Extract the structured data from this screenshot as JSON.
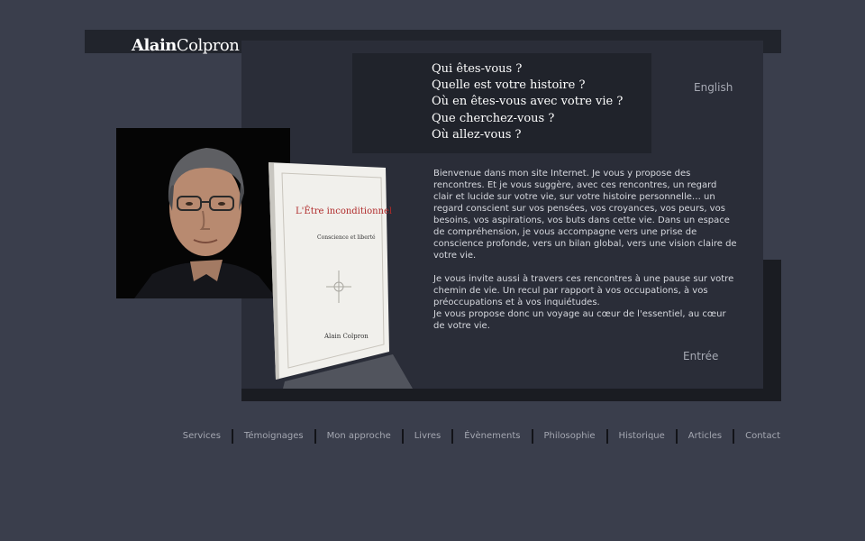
{
  "logo": {
    "first": "Alain",
    "last": "Colpron"
  },
  "questions": [
    "Qui êtes-vous ?",
    "Quelle est votre histoire ?",
    "Où en êtes-vous avec votre vie ?",
    "Que cherchez-vous ?",
    "Où allez-vous ?"
  ],
  "language_link": "English",
  "book": {
    "title": "L'Être inconditionnel",
    "subtitle": "Conscience et liberté",
    "author": "Alain Colpron"
  },
  "intro": {
    "p1": "Bienvenue dans mon site Internet. Je vous y propose des rencontres. Et je vous suggère, avec ces rencontres, un regard clair et lucide sur votre vie, sur votre histoire personnelle… un regard conscient sur vos pensées, vos croyances, vos peurs, vos besoins, vos aspirations, vos buts dans cette vie. Dans un espace de compréhension, je vous accompagne vers une prise de conscience profonde, vers un bilan global, vers une vision claire de votre vie.",
    "p2": "Je vous invite aussi à travers ces rencontres à une pause sur votre chemin de vie. Un recul par rapport à vos occupations, à vos préoccupations et à vos inquiétudes.",
    "p3": "Je vous propose donc un voyage au cœur de l'essentiel, au cœur de votre vie."
  },
  "entry_link": "Entrée",
  "nav": [
    "Services",
    "Témoignages",
    "Mon approche",
    "Livres",
    "Évènements",
    "Philosophie",
    "Historique",
    "Articles",
    "Contact"
  ],
  "colors": {
    "background": "#3a3e4c",
    "panel": "#2a2d38",
    "question_box": "#20232b",
    "link": "#a7aab4"
  }
}
